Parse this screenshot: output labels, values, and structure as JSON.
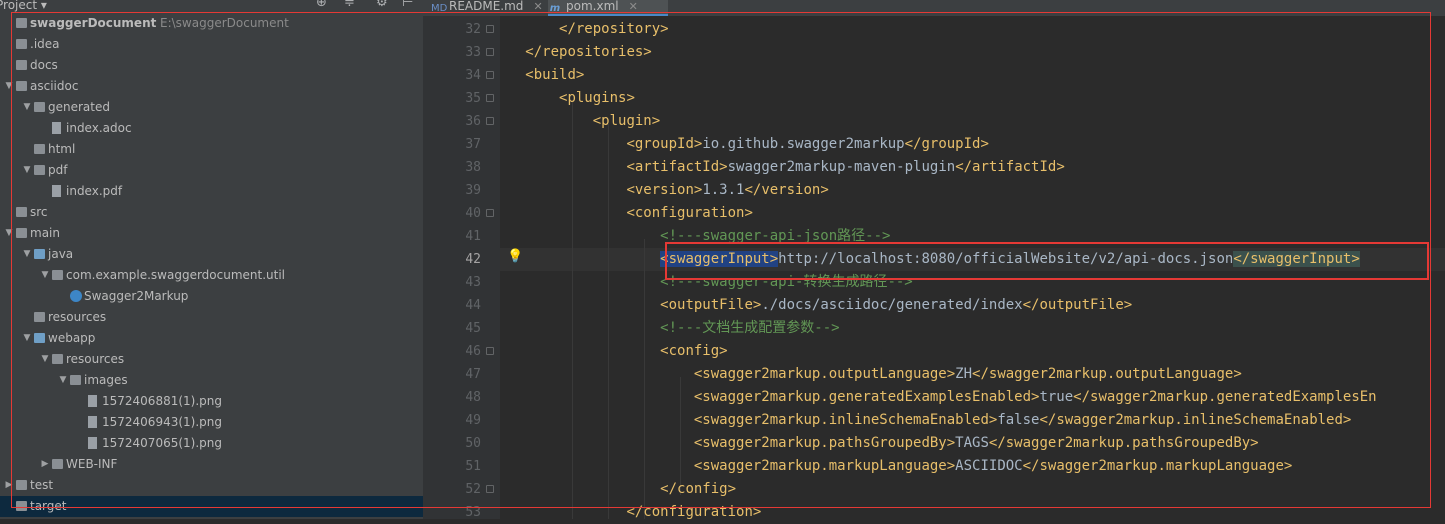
{
  "panel": {
    "title": "Project ▾",
    "tree": [
      {
        "label": "swaggerDocument",
        "sub": "E:\\swaggerDocument",
        "depth": 0,
        "arrow": "",
        "icon": "folder",
        "bold": true
      },
      {
        "label": ".idea",
        "depth": 0,
        "arrow": "",
        "icon": "folder"
      },
      {
        "label": "docs",
        "depth": 0,
        "arrow": "",
        "icon": "folder"
      },
      {
        "label": "asciidoc",
        "depth": 0,
        "arrow": "▼",
        "icon": "folder"
      },
      {
        "label": "generated",
        "depth": 1,
        "arrow": "▼",
        "icon": "folder"
      },
      {
        "label": "index.adoc",
        "depth": 2,
        "arrow": "",
        "icon": "file"
      },
      {
        "label": "html",
        "depth": 1,
        "arrow": "",
        "icon": "folder"
      },
      {
        "label": "pdf",
        "depth": 1,
        "arrow": "▼",
        "icon": "folder"
      },
      {
        "label": "index.pdf",
        "depth": 2,
        "arrow": "",
        "icon": "file"
      },
      {
        "label": "src",
        "depth": 0,
        "arrow": "",
        "icon": "folder"
      },
      {
        "label": "main",
        "depth": 0,
        "arrow": "▼",
        "icon": "folder"
      },
      {
        "label": "java",
        "depth": 1,
        "arrow": "▼",
        "icon": "folder-blue"
      },
      {
        "label": "com.example.swaggerdocument.util",
        "depth": 2,
        "arrow": "▼",
        "icon": "folder"
      },
      {
        "label": "Swagger2Markup",
        "depth": 3,
        "arrow": "",
        "icon": "class"
      },
      {
        "label": "resources",
        "depth": 1,
        "arrow": "",
        "icon": "folder"
      },
      {
        "label": "webapp",
        "depth": 1,
        "arrow": "▼",
        "icon": "folder-blue"
      },
      {
        "label": "resources",
        "depth": 2,
        "arrow": "▼",
        "icon": "folder"
      },
      {
        "label": "images",
        "depth": 3,
        "arrow": "▼",
        "icon": "folder"
      },
      {
        "label": "1572406881(1).png",
        "depth": 4,
        "arrow": "",
        "icon": "file"
      },
      {
        "label": "1572406943(1).png",
        "depth": 4,
        "arrow": "",
        "icon": "file"
      },
      {
        "label": "1572407065(1).png",
        "depth": 4,
        "arrow": "",
        "icon": "file"
      },
      {
        "label": "WEB-INF",
        "depth": 2,
        "arrow": "▶",
        "icon": "folder"
      },
      {
        "label": "test",
        "depth": 0,
        "arrow": "▶",
        "icon": "folder"
      },
      {
        "label": "target",
        "depth": 0,
        "arrow": "",
        "icon": "folder",
        "selected": true
      }
    ]
  },
  "tabs": [
    {
      "label": "README.md",
      "icon": "MD"
    },
    {
      "label": "pom.xml",
      "icon": "m",
      "active": true
    }
  ],
  "editor": {
    "current_line": 42,
    "lines": [
      {
        "n": 32,
        "indent": "    ",
        "parts": [
          [
            "tag",
            "</repository>"
          ]
        ]
      },
      {
        "n": 33,
        "indent": "",
        "parts": [
          [
            "tag",
            "</repositories>"
          ]
        ]
      },
      {
        "n": 34,
        "indent": "",
        "parts": [
          [
            "tag",
            "<build>"
          ]
        ]
      },
      {
        "n": 35,
        "indent": "    ",
        "parts": [
          [
            "tag",
            "<plugins>"
          ]
        ]
      },
      {
        "n": 36,
        "indent": "        ",
        "parts": [
          [
            "tag",
            "<plugin>"
          ]
        ]
      },
      {
        "n": 37,
        "indent": "            ",
        "parts": [
          [
            "tag",
            "<groupId>"
          ],
          [
            "text",
            "io.github.swagger2markup"
          ],
          [
            "tag",
            "</groupId>"
          ]
        ]
      },
      {
        "n": 38,
        "indent": "            ",
        "parts": [
          [
            "tag",
            "<artifactId>"
          ],
          [
            "text",
            "swagger2markup-maven-plugin"
          ],
          [
            "tag",
            "</artifactId>"
          ]
        ]
      },
      {
        "n": 39,
        "indent": "            ",
        "parts": [
          [
            "tag",
            "<version>"
          ],
          [
            "text",
            "1.3.1"
          ],
          [
            "tag",
            "</version>"
          ]
        ]
      },
      {
        "n": 40,
        "indent": "            ",
        "parts": [
          [
            "tag",
            "<configuration>"
          ]
        ]
      },
      {
        "n": 41,
        "indent": "                ",
        "parts": [
          [
            "comment",
            "<!---swagger-api-json路径-->"
          ]
        ]
      },
      {
        "n": 42,
        "indent": "                ",
        "parts": [
          [
            "tag-sel",
            "<swaggerInput>"
          ],
          [
            "text",
            "http://localhost:8080/officialWebsite/v2/api-docs.json"
          ],
          [
            "tag-hl",
            "</swaggerInput>"
          ]
        ]
      },
      {
        "n": 43,
        "indent": "                ",
        "parts": [
          [
            "comment",
            "<!---swagger-api-转换生成路径-->"
          ]
        ]
      },
      {
        "n": 44,
        "indent": "                ",
        "parts": [
          [
            "tag",
            "<outputFile>"
          ],
          [
            "text",
            "./docs/asciidoc/generated/index"
          ],
          [
            "tag",
            "</outputFile>"
          ]
        ]
      },
      {
        "n": 45,
        "indent": "                ",
        "parts": [
          [
            "comment",
            "<!---文档生成配置参数-->"
          ]
        ]
      },
      {
        "n": 46,
        "indent": "                ",
        "parts": [
          [
            "tag",
            "<config>"
          ]
        ]
      },
      {
        "n": 47,
        "indent": "                    ",
        "parts": [
          [
            "tag",
            "<swagger2markup.outputLanguage>"
          ],
          [
            "text",
            "ZH"
          ],
          [
            "tag",
            "</swagger2markup.outputLanguage>"
          ]
        ]
      },
      {
        "n": 48,
        "indent": "                    ",
        "parts": [
          [
            "tag",
            "<swagger2markup.generatedExamplesEnabled>"
          ],
          [
            "text",
            "true"
          ],
          [
            "tag",
            "</swagger2markup.generatedExamplesEn"
          ]
        ]
      },
      {
        "n": 49,
        "indent": "                    ",
        "parts": [
          [
            "tag",
            "<swagger2markup.inlineSchemaEnabled>"
          ],
          [
            "text",
            "false"
          ],
          [
            "tag",
            "</swagger2markup.inlineSchemaEnabled>"
          ]
        ]
      },
      {
        "n": 50,
        "indent": "                    ",
        "parts": [
          [
            "tag",
            "<swagger2markup.pathsGroupedBy>"
          ],
          [
            "text",
            "TAGS"
          ],
          [
            "tag",
            "</swagger2markup.pathsGroupedBy>"
          ]
        ]
      },
      {
        "n": 51,
        "indent": "                    ",
        "parts": [
          [
            "tag",
            "<swagger2markup.markupLanguage>"
          ],
          [
            "text",
            "ASCIIDOC"
          ],
          [
            "tag",
            "</swagger2markup.markupLanguage>"
          ]
        ]
      },
      {
        "n": 52,
        "indent": "                ",
        "parts": [
          [
            "tag",
            "</config>"
          ]
        ]
      },
      {
        "n": 53,
        "indent": "            ",
        "parts": [
          [
            "tag",
            "</configuration>"
          ]
        ]
      }
    ]
  }
}
